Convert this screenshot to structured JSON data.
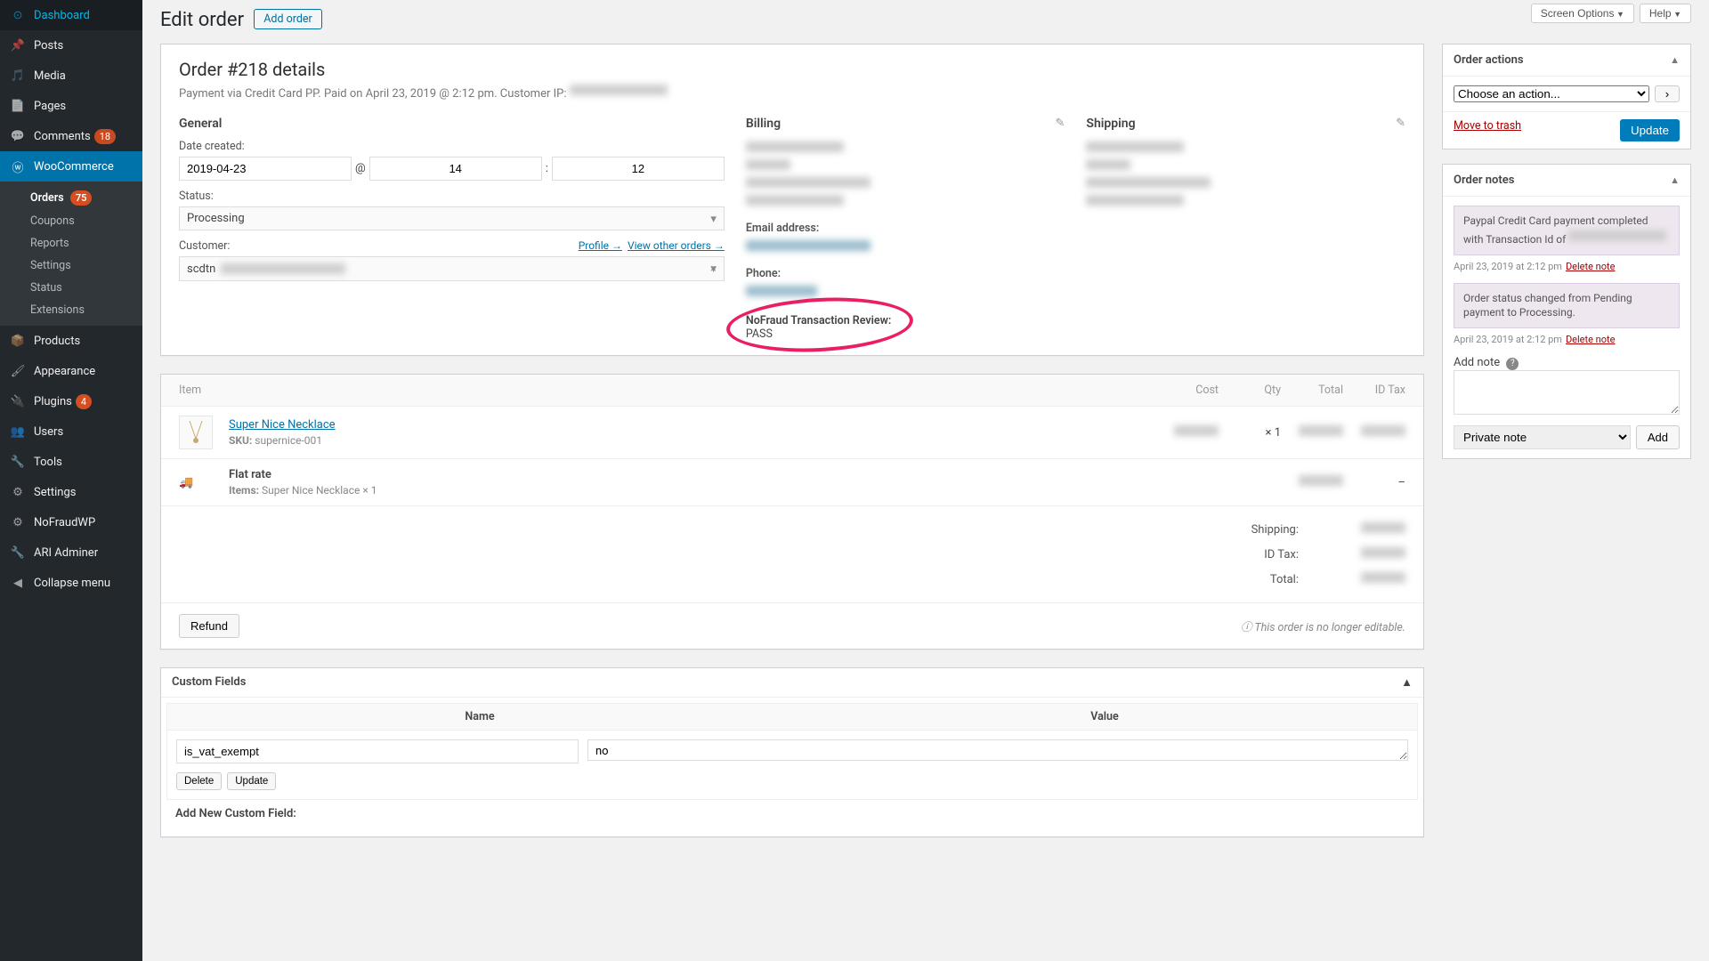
{
  "topbar": {
    "screen": "Screen Options",
    "help": "Help"
  },
  "sidebar": [
    {
      "icon": "dashboard",
      "label": "Dashboard"
    },
    {
      "icon": "pin",
      "label": "Posts"
    },
    {
      "icon": "media",
      "label": "Media"
    },
    {
      "icon": "page",
      "label": "Pages"
    },
    {
      "icon": "comment",
      "label": "Comments",
      "badge": "18"
    },
    {
      "icon": "woo",
      "label": "WooCommerce",
      "active": true
    },
    {
      "icon": "box",
      "label": "Products"
    },
    {
      "icon": "brush",
      "label": "Appearance"
    },
    {
      "icon": "plug",
      "label": "Plugins",
      "badge": "4"
    },
    {
      "icon": "users",
      "label": "Users"
    },
    {
      "icon": "wrench",
      "label": "Tools"
    },
    {
      "icon": "gear",
      "label": "Settings"
    },
    {
      "icon": "gear",
      "label": "NoFraudWP"
    },
    {
      "icon": "wrench",
      "label": "ARI Adminer"
    },
    {
      "icon": "collapse",
      "label": "Collapse menu"
    }
  ],
  "submenu": [
    {
      "label": "Orders",
      "badge": "75",
      "current": true
    },
    {
      "label": "Coupons"
    },
    {
      "label": "Reports"
    },
    {
      "label": "Settings"
    },
    {
      "label": "Status"
    },
    {
      "label": "Extensions"
    }
  ],
  "page": {
    "title": "Edit order",
    "add": "Add order"
  },
  "order": {
    "title": "Order #218 details",
    "meta": "Payment via Credit Card PP. Paid on April 23, 2019 @ 2:12 pm. Customer IP: ",
    "general": {
      "heading": "General",
      "dateLabel": "Date created:",
      "date": "2019-04-23",
      "at": "@",
      "hour": "14",
      "colon": ":",
      "min": "12",
      "statusLabel": "Status:",
      "status": "Processing",
      "customerLabel": "Customer:",
      "profile": "Profile →",
      "viewOther": "View other orders →",
      "customer": "scdtn"
    },
    "billing": {
      "heading": "Billing",
      "emailLabel": "Email address:",
      "phoneLabel": "Phone:",
      "nfLabel": "NoFraud Transaction Review:",
      "nfResult": "PASS"
    },
    "shipping": {
      "heading": "Shipping"
    }
  },
  "items": {
    "head": {
      "item": "Item",
      "cost": "Cost",
      "qty": "Qty",
      "total": "Total",
      "tax": "ID Tax"
    },
    "product": {
      "name": "Super Nice Necklace",
      "skuLabel": "SKU:",
      "sku": "supernice-001",
      "qty": "× 1"
    },
    "shipping": {
      "name": "Flat rate",
      "itemsLabel": "Items:",
      "itemsText": "Super Nice Necklace × 1",
      "dash": "–"
    },
    "totals": {
      "shipping": "Shipping:",
      "tax": "ID Tax:",
      "total": "Total:"
    },
    "refund": "Refund",
    "noEdit": "This order is no longer editable."
  },
  "cf": {
    "title": "Custom Fields",
    "nameH": "Name",
    "valueH": "Value",
    "name": "is_vat_exempt",
    "value": "no",
    "delete": "Delete",
    "update": "Update",
    "addNew": "Add New Custom Field:"
  },
  "actions": {
    "title": "Order actions",
    "choose": "Choose an action...",
    "trash": "Move to trash",
    "update": "Update"
  },
  "notes": {
    "title": "Order notes",
    "n1": "Paypal Credit Card payment completed with Transaction Id of",
    "n2": "Order status changed from Pending payment to Processing.",
    "meta": "April 23, 2019 at 2:12 pm",
    "del": "Delete note",
    "addLabel": "Add note",
    "private": "Private note",
    "add": "Add"
  }
}
